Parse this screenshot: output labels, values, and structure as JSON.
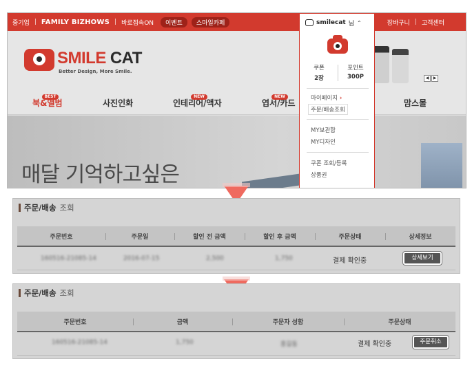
{
  "topbar": {
    "items": [
      "중기업",
      "FAMILY BIZHOWS",
      "바로접속ON"
    ],
    "pills": [
      "이벤트",
      "스마일카페"
    ],
    "right_items": [
      "장바구니",
      "고객센터"
    ]
  },
  "logo": {
    "brand_a": "SMILE",
    "brand_b": "CAT",
    "tagline": "Better Design, More Smile."
  },
  "nav": {
    "items": [
      {
        "label": "북&앨범",
        "badge": "BEST"
      },
      {
        "label": "사진인화",
        "badge": ""
      },
      {
        "label": "인테리어/액자",
        "badge": "NEW"
      },
      {
        "label": "엽서/카드",
        "badge": "NEW"
      },
      {
        "label": "맘스몰",
        "badge": ""
      }
    ]
  },
  "banner": {
    "slogan": "매달 기억하고싶은"
  },
  "dropdown": {
    "user": "smilecat",
    "suffix": "님",
    "coupon_label": "쿠폰",
    "coupon_value": "2장",
    "point_label": "포인트",
    "point_value": "300P",
    "links": [
      "마이페이지",
      "주문/배송조회",
      "MY보관함",
      "MY디자인",
      "쿠폰 조회/등록",
      "상품권"
    ]
  },
  "table1": {
    "title_bold": "주문/배송",
    "title_light": "조회",
    "headers": [
      "주문번호",
      "주문일",
      "할인 전 금액",
      "할인 후 금액",
      "주문상태",
      "상세정보"
    ],
    "row": [
      "160516-21085-14",
      "2016-07-15",
      "2,500",
      "1,750"
    ],
    "status": "결제 확인중",
    "button": "상세보기"
  },
  "table2": {
    "title_bold": "주문/배송",
    "title_light": "조회",
    "headers": [
      "주문번호",
      "금액",
      "주문자 성함",
      "주문상태"
    ],
    "row": [
      "160516-21085-14",
      "1,750",
      "홍길동"
    ],
    "status": "결제 확인중",
    "button": "주문취소"
  }
}
